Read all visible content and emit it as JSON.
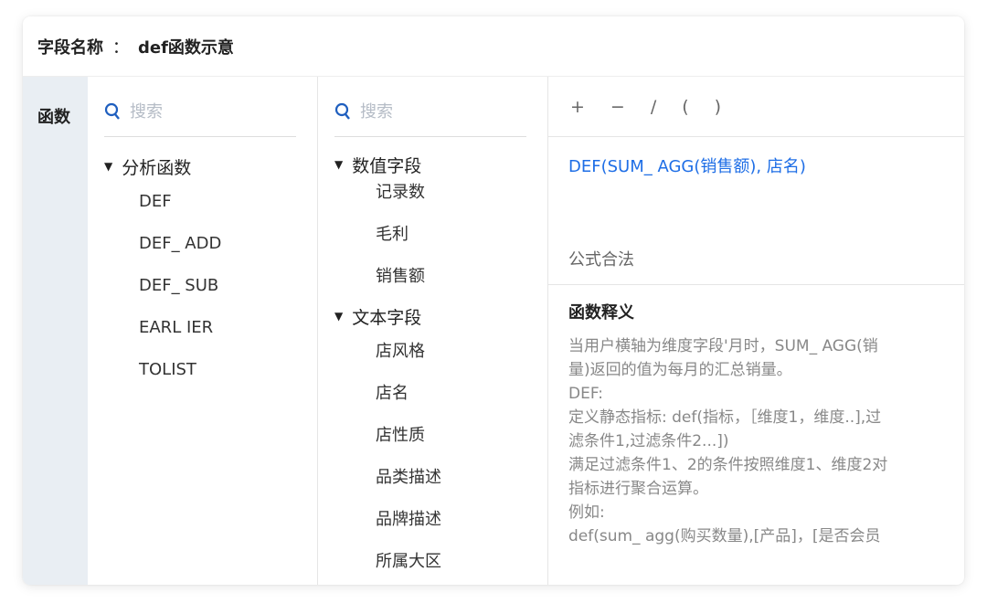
{
  "header": {
    "label": "字段名称",
    "separator": "：",
    "value": "def函数示意"
  },
  "left_tab": {
    "label": "函数"
  },
  "function_panel": {
    "search_placeholder": "搜索",
    "group_label": "分析函数",
    "items": [
      "DEF",
      "DEF_ ADD",
      "DEF_ SUB",
      "EARL IER",
      "TOLIST"
    ]
  },
  "field_panel": {
    "search_placeholder": "搜索",
    "groups": [
      {
        "label": "数值字段",
        "items": [
          "记录数",
          "毛利",
          "销售额"
        ]
      },
      {
        "label": "文本字段",
        "items": [
          "店风格",
          "店名",
          "店性质",
          "品类描述",
          "品牌描述",
          "所属大区"
        ]
      }
    ]
  },
  "operators": [
    "+",
    "−",
    "/",
    "(",
    ")"
  ],
  "formula": {
    "expression": "DEF(SUM_ AGG(销售额), 店名)",
    "status": "公式合法"
  },
  "explanation": {
    "title": "函数释义",
    "lines": [
      "当用户横轴为维度字段'月时，SUM_ AGG(销",
      "量)返回的值为每月的汇总销量。",
      "DEF:",
      "定义静态指标: def(指标，［维度1，维度..],过",
      "滤条件1,过滤条件2...])",
      "满足过滤条件1、2的条件按照维度1、维度2对",
      "指标进行聚合运算。",
      "例如:",
      "def(sum_ agg(购买数量),[产品]，[是否会员"
    ]
  },
  "colors": {
    "accent": "#1e6ee6",
    "tab_bg": "#e9eef3"
  }
}
